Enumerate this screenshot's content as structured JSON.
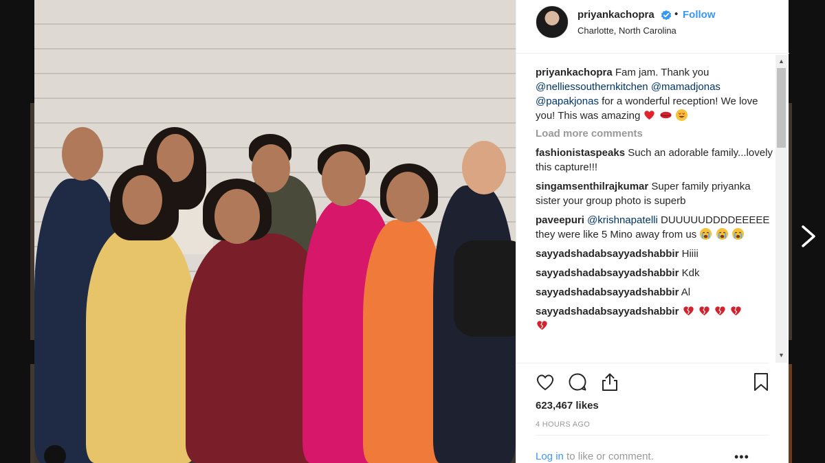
{
  "post": {
    "username": "priyankachopra",
    "separator": "•",
    "follow_label": "Follow",
    "location": "Charlotte, North Carolina",
    "caption": {
      "author": "priyankachopra",
      "text_1": "Fam jam. Thank you",
      "mention_1": "@nelliessouthernkitchen",
      "mention_2": "@mamadjonas",
      "mention_3": "@papakjonas",
      "text_2": "for a wonderful reception! We love you! This was amazing"
    },
    "load_more_label": "Load more comments",
    "comments": [
      {
        "user": "fashionistaspeaks",
        "text": "Such an adorable family...lovely this capture!!!"
      },
      {
        "user": "singamsenthilrajkumar",
        "text": "Super family priyanka sister your group photo is superb"
      },
      {
        "user": "paveepuri",
        "mention": "@krishnapatelli",
        "text": "DUUUUUDDDDEEEEE they were like 5 Mino away from us"
      },
      {
        "user": "sayyadshadabsayyadshabbir",
        "text": "Hiiii"
      },
      {
        "user": "sayyadshadabsayyadshabbir",
        "text": "Kdk"
      },
      {
        "user": "sayyadshadabsayyadshabbir",
        "text": "Al"
      },
      {
        "user": "sayyadshadabsayyadshabbir",
        "text": ""
      }
    ],
    "likes": "623,467 likes",
    "time": "4 HOURS AGO",
    "login_link": "Log in",
    "login_text": "to like or comment.",
    "more_label": "•••"
  },
  "colors": {
    "accent": "#3897f0",
    "text": "#262626",
    "muted": "#999999",
    "heart": "#ed4956"
  },
  "icons": [
    "verified-badge-icon",
    "heart-icon",
    "comment-icon",
    "share-icon",
    "bookmark-icon",
    "next-arrow-icon",
    "more-options-icon"
  ]
}
